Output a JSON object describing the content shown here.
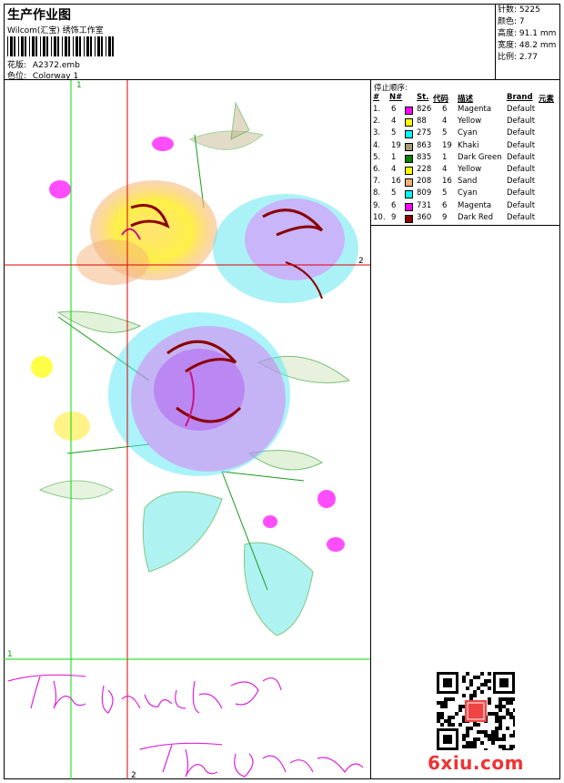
{
  "header": {
    "title": "生产作业图",
    "company": "Wilcom(汇宝) 绣饰工作室",
    "design_label": "花版:",
    "design_value": "A2372.emb",
    "colorway_label": "色位:",
    "colorway_value": "Colorway 1"
  },
  "stats": {
    "stitches_label": "针数:",
    "stitches_value": "5225",
    "colors_label": "颜色:",
    "colors_value": "7",
    "height_label": "高度:",
    "height_value": "91.1 mm",
    "width_label": "宽度:",
    "width_value": "48.2 mm",
    "scale_label": "比例:",
    "scale_value": "2.77"
  },
  "stop_sequence": {
    "title": "停止顺序:",
    "columns": [
      "#",
      "N#",
      "St.",
      "代码",
      "描述",
      "Brand",
      "元素"
    ],
    "rows": [
      {
        "idx": "1.",
        "n": "6",
        "st": "826",
        "code": "6",
        "desc": "Magenta",
        "brand": "Default",
        "color": "#ff00ff"
      },
      {
        "idx": "2.",
        "n": "4",
        "st": "88",
        "code": "4",
        "desc": "Yellow",
        "brand": "Default",
        "color": "#ffff00"
      },
      {
        "idx": "3.",
        "n": "5",
        "st": "275",
        "code": "5",
        "desc": "Cyan",
        "brand": "Default",
        "color": "#00ffff"
      },
      {
        "idx": "4.",
        "n": "19",
        "st": "863",
        "code": "19",
        "desc": "Khaki",
        "brand": "Default",
        "color": "#a89877"
      },
      {
        "idx": "5.",
        "n": "1",
        "st": "835",
        "code": "1",
        "desc": "Dark Green",
        "brand": "Default",
        "color": "#008000"
      },
      {
        "idx": "6.",
        "n": "4",
        "st": "228",
        "code": "4",
        "desc": "Yellow",
        "brand": "Default",
        "color": "#ffff00"
      },
      {
        "idx": "7.",
        "n": "16",
        "st": "208",
        "code": "16",
        "desc": "Sand",
        "brand": "Default",
        "color": "#f4b27a"
      },
      {
        "idx": "8.",
        "n": "5",
        "st": "809",
        "code": "5",
        "desc": "Cyan",
        "brand": "Default",
        "color": "#00ffff"
      },
      {
        "idx": "9.",
        "n": "6",
        "st": "731",
        "code": "6",
        "desc": "Magenta",
        "brand": "Default",
        "color": "#ff00ff"
      },
      {
        "idx": "10.",
        "n": "9",
        "st": "360",
        "code": "9",
        "desc": "Dark Red",
        "brand": "Default",
        "color": "#8b0000"
      }
    ]
  },
  "guides": {
    "v1_label": "1",
    "v2_label": "2",
    "h1_label": "1",
    "h2_label": "2",
    "green": "#00dd00",
    "red": "#dd0000"
  },
  "watermark": "6xiu.com",
  "signature_text": "The beauty of The flower"
}
